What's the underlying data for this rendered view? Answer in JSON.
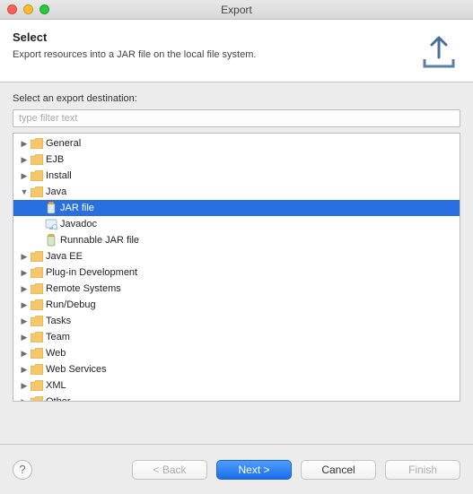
{
  "window": {
    "title": "Export"
  },
  "header": {
    "title": "Select",
    "subtitle": "Export resources into a JAR file on the local file system."
  },
  "body": {
    "label": "Select an export destination:",
    "filter_placeholder": "type filter text"
  },
  "tree": [
    {
      "label": "General",
      "indent": 0,
      "expanded": false,
      "icon": "folder"
    },
    {
      "label": "EJB",
      "indent": 0,
      "expanded": false,
      "icon": "folder"
    },
    {
      "label": "Install",
      "indent": 0,
      "expanded": false,
      "icon": "folder"
    },
    {
      "label": "Java",
      "indent": 0,
      "expanded": true,
      "icon": "folder"
    },
    {
      "label": "JAR file",
      "indent": 1,
      "leaf": true,
      "icon": "jar",
      "selected": true
    },
    {
      "label": "Javadoc",
      "indent": 1,
      "leaf": true,
      "icon": "javadoc"
    },
    {
      "label": "Runnable JAR file",
      "indent": 1,
      "leaf": true,
      "icon": "jar"
    },
    {
      "label": "Java EE",
      "indent": 0,
      "expanded": false,
      "icon": "folder"
    },
    {
      "label": "Plug-in Development",
      "indent": 0,
      "expanded": false,
      "icon": "folder"
    },
    {
      "label": "Remote Systems",
      "indent": 0,
      "expanded": false,
      "icon": "folder"
    },
    {
      "label": "Run/Debug",
      "indent": 0,
      "expanded": false,
      "icon": "folder"
    },
    {
      "label": "Tasks",
      "indent": 0,
      "expanded": false,
      "icon": "folder"
    },
    {
      "label": "Team",
      "indent": 0,
      "expanded": false,
      "icon": "folder"
    },
    {
      "label": "Web",
      "indent": 0,
      "expanded": false,
      "icon": "folder"
    },
    {
      "label": "Web Services",
      "indent": 0,
      "expanded": false,
      "icon": "folder"
    },
    {
      "label": "XML",
      "indent": 0,
      "expanded": false,
      "icon": "folder"
    },
    {
      "label": "Other",
      "indent": 0,
      "expanded": false,
      "icon": "folder"
    }
  ],
  "footer": {
    "back": "< Back",
    "next": "Next >",
    "cancel": "Cancel",
    "finish": "Finish"
  }
}
